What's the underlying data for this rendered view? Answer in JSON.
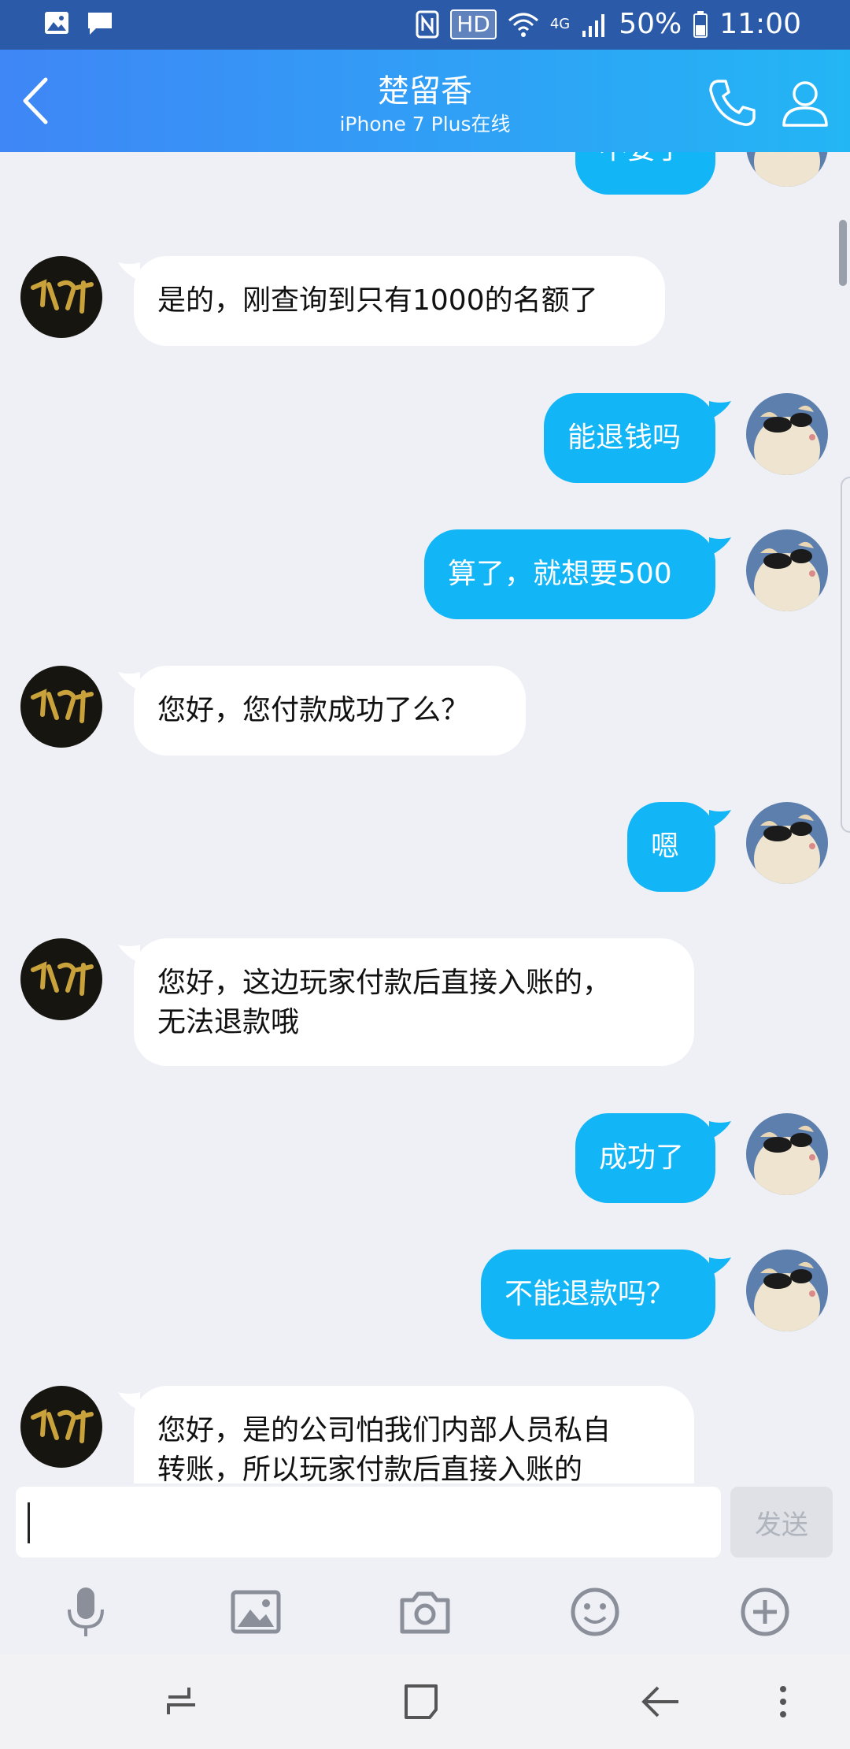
{
  "status_bar": {
    "battery": "50%",
    "time": "11:00",
    "hd": "HD",
    "network": "4G",
    "icons": [
      "gallery-icon",
      "message-icon",
      "nfc-icon",
      "wifi-icon",
      "signal-icon",
      "battery-icon"
    ]
  },
  "header": {
    "title": "楚留香",
    "subtitle": "iPhone 7 Plus在线"
  },
  "messages": [
    {
      "side": "out",
      "text": "不要了"
    },
    {
      "side": "in",
      "text": "是的，刚查询到只有1000的名额了"
    },
    {
      "side": "out",
      "text": "能退钱吗"
    },
    {
      "side": "out",
      "text": "算了，就想要500"
    },
    {
      "side": "in",
      "text": "您好，您付款成功了么？"
    },
    {
      "side": "out",
      "text": "嗯"
    },
    {
      "side": "in",
      "text": "您好，这边玩家付款后直接入账的，\n无法退款哦"
    },
    {
      "side": "out",
      "text": "成功了"
    },
    {
      "side": "out",
      "text": "不能退款吗？"
    },
    {
      "side": "in",
      "text": "您好，是的公司怕我们内部人员私自\n转账，所以玩家付款后直接入账的"
    }
  ],
  "input": {
    "value": "",
    "send_label": "发送"
  },
  "toolbar": [
    "mic-icon",
    "image-icon",
    "camera-icon",
    "emoji-icon",
    "plus-icon"
  ],
  "colors": {
    "header_start": "#3f86f6",
    "header_end": "#23b6f5",
    "bubble_out": "#12b5f5",
    "bubble_in": "#ffffff",
    "background": "#eef0f6"
  }
}
